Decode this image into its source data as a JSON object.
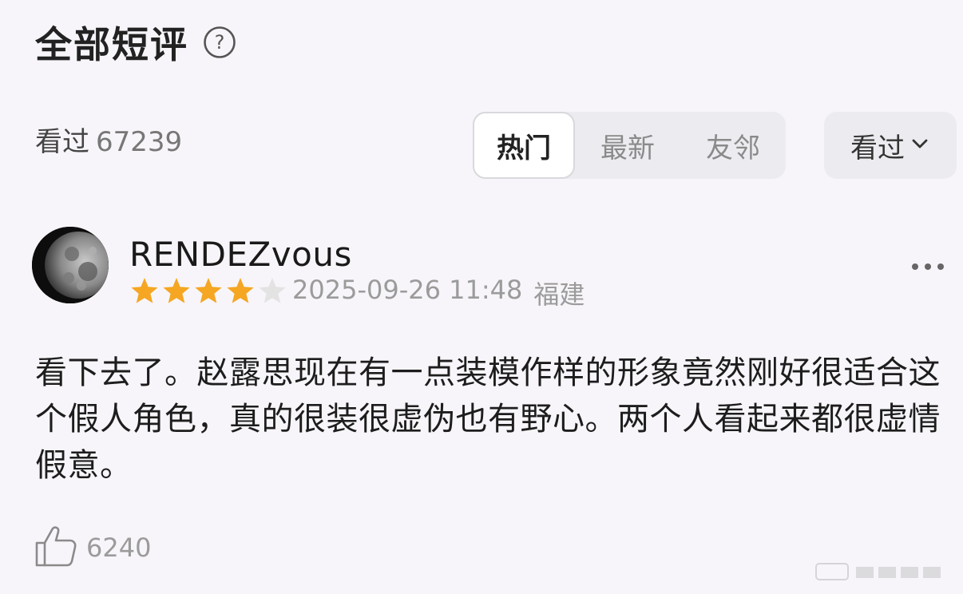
{
  "header": {
    "title": "全部短评",
    "help_icon": "question-circle-icon"
  },
  "stats": {
    "label": "看过",
    "count": "67239"
  },
  "sort_tabs": [
    {
      "label": "热门",
      "active": true
    },
    {
      "label": "最新",
      "active": false
    },
    {
      "label": "友邻",
      "active": false
    }
  ],
  "filter": {
    "label": "看过",
    "icon": "chevron-down-icon"
  },
  "review": {
    "username": "RENDEZvous",
    "rating": {
      "value": 4,
      "max": 5
    },
    "date": "2025-09-26 11:48",
    "location": "福建",
    "text": "看下去了。赵露思现在有一点装模作样的形象竟然刚好很适合这个假人角色，真的很装很虚伪也有野心。两个人看起来都很虚情假意。",
    "likes": "6240",
    "like_icon": "thumbs-up-icon",
    "more_icon": "more-horizontal-icon"
  },
  "colors": {
    "background": "#f7f5f9",
    "star_filled": "#f5a623",
    "star_empty": "#e3e3e3",
    "segment_bg": "#ecebef"
  }
}
